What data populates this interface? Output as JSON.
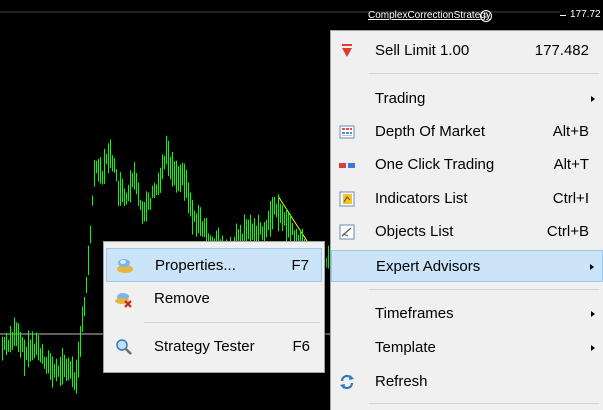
{
  "chart": {
    "ea_name": "ComplexCorrectionStrategy",
    "price_label": "177.72"
  },
  "context_menu": {
    "items": [
      {
        "label": "Sell Limit 1.00",
        "shortcut": "177.482",
        "icon": "sell-arrow-icon"
      },
      {
        "label": "Trading",
        "shortcut": "",
        "submenu": true
      },
      {
        "label": "Depth Of Market",
        "shortcut": "Alt+B",
        "icon": "depth-of-market-icon"
      },
      {
        "label": "One Click Trading",
        "shortcut": "Alt+T",
        "icon": "one-click-trading-icon"
      },
      {
        "label": "Indicators List",
        "shortcut": "Ctrl+I",
        "icon": "indicators-list-icon"
      },
      {
        "label": "Objects List",
        "shortcut": "Ctrl+B",
        "icon": "objects-list-icon"
      },
      {
        "label": "Expert Advisors",
        "shortcut": "",
        "submenu": true,
        "highlighted": true
      },
      {
        "label": "Timeframes",
        "shortcut": "",
        "submenu": true
      },
      {
        "label": "Template",
        "shortcut": "",
        "submenu": true
      },
      {
        "label": "Refresh",
        "shortcut": "",
        "icon": "refresh-icon"
      }
    ]
  },
  "submenu": {
    "items": [
      {
        "label": "Properties...",
        "shortcut": "F7",
        "icon": "properties-icon",
        "highlighted": true
      },
      {
        "label": "Remove",
        "shortcut": "",
        "icon": "remove-icon"
      },
      {
        "label": "Strategy Tester",
        "shortcut": "F6",
        "icon": "strategy-tester-icon"
      }
    ]
  },
  "colors": {
    "chart_background": "#000000",
    "candles": "#00ff00",
    "menu_background": "#f0f0f0",
    "highlight": "#cce4f7",
    "sell_arrow": "#e03c2a"
  }
}
